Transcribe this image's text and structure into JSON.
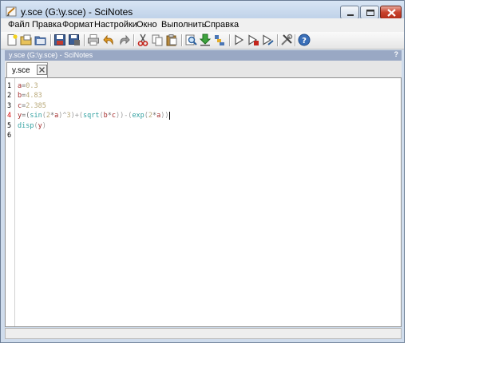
{
  "window": {
    "title": "y.sce (G:\\y.sce) - SciNotes",
    "buttons": [
      "minimize-icon",
      "maximize-icon",
      "close-icon"
    ]
  },
  "menu": [
    "Файл",
    "Правка",
    "Формат",
    "Настройки",
    "Окно",
    "Выполнить",
    "Справка"
  ],
  "toolbar": {
    "icons": [
      "new-file-icon",
      "open-file-icon",
      "open-folder-icon",
      "save-icon",
      "save-as-icon",
      "print-icon",
      "undo-icon",
      "redo-icon",
      "cut-icon",
      "copy-icon",
      "paste-icon",
      "find-replace-icon",
      "load-into-scilab-icon",
      "execute-file-icon",
      "execute-icon",
      "execute-echo-icon",
      "execute-selection-icon",
      "preferences-icon",
      "help-icon"
    ]
  },
  "panel": {
    "title": "y.sce (G:\\y.sce) - SciNotes",
    "help": "?"
  },
  "tab": {
    "label": "y.sce",
    "close_icon": "close-tab-icon"
  },
  "editor": {
    "line_numbers": [
      "1",
      "2",
      "3",
      "4",
      "5",
      "6"
    ],
    "error_line": "4",
    "lines": [
      [
        {
          "t": "a",
          "c": "var"
        },
        {
          "t": "=",
          "c": "op"
        },
        {
          "t": "0.3",
          "c": "num"
        }
      ],
      [
        {
          "t": "b",
          "c": "var"
        },
        {
          "t": "=",
          "c": "op"
        },
        {
          "t": "4.83",
          "c": "num"
        }
      ],
      [
        {
          "t": "c",
          "c": "var"
        },
        {
          "t": "=",
          "c": "op"
        },
        {
          "t": "2.385",
          "c": "num"
        }
      ],
      [
        {
          "t": "y",
          "c": "var"
        },
        {
          "t": "=(",
          "c": "op"
        },
        {
          "t": "sin",
          "c": "fn"
        },
        {
          "t": "(",
          "c": "par"
        },
        {
          "t": "2",
          "c": "num"
        },
        {
          "t": "*",
          "c": "op"
        },
        {
          "t": "a",
          "c": "var"
        },
        {
          "t": ")^",
          "c": "par"
        },
        {
          "t": "3",
          "c": "num"
        },
        {
          "t": ")+(",
          "c": "par"
        },
        {
          "t": "sqrt",
          "c": "fn"
        },
        {
          "t": "(",
          "c": "par"
        },
        {
          "t": "b",
          "c": "var"
        },
        {
          "t": "*",
          "c": "op"
        },
        {
          "t": "c",
          "c": "var"
        },
        {
          "t": "))-(",
          "c": "par"
        },
        {
          "t": "exp",
          "c": "fn"
        },
        {
          "t": "(",
          "c": "par"
        },
        {
          "t": "2",
          "c": "num"
        },
        {
          "t": "*",
          "c": "op"
        },
        {
          "t": "a",
          "c": "var"
        },
        {
          "t": "))",
          "c": "par"
        }
      ],
      [
        {
          "t": "disp",
          "c": "fn"
        },
        {
          "t": "(",
          "c": "par"
        },
        {
          "t": "y",
          "c": "var"
        },
        {
          "t": ")",
          "c": "par"
        }
      ],
      []
    ]
  },
  "colors": {
    "variable": "#a42b2b",
    "operator": "#707070",
    "number": "#b8a878",
    "function": "#30a0a0",
    "error_line_number": "#d10000",
    "panel_header": "#99a8c4"
  }
}
